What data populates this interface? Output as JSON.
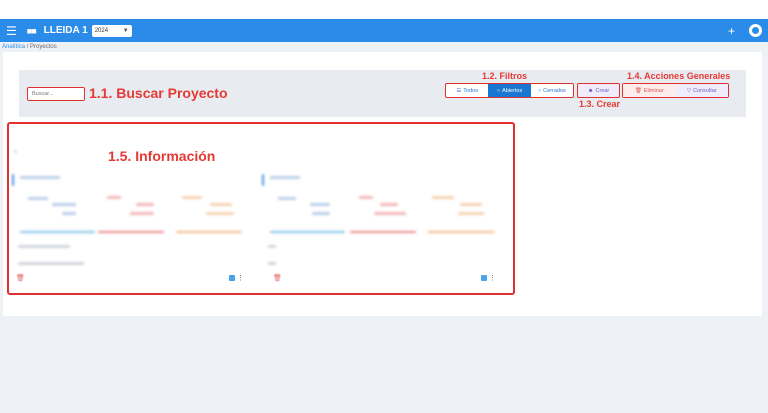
{
  "appbar": {
    "title": "LLEIDA 1",
    "year": "2024",
    "menu_icon": "hamburger-icon",
    "apps_icon": "apps-grid-icon",
    "add_icon": "plus-icon",
    "avatar_icon": "user-avatar-icon"
  },
  "breadcrumb": {
    "root": "Analítica",
    "separator": "/",
    "current": "Proyectos"
  },
  "search": {
    "placeholder": "Buscar..."
  },
  "filters": {
    "todos": "Todos",
    "abiertos": "Abiertos",
    "cerrados": "Cerrados"
  },
  "actions": {
    "crear": "Crear",
    "eliminar": "Eliminar",
    "consultar": "Consultar"
  },
  "annotations": {
    "a11": "1.1. Buscar Proyecto",
    "a12": "1.2. Filtros",
    "a13": "1.3. Crear",
    "a14": "1.4. Acciones Generales",
    "a15": "1.5. Información"
  },
  "colors": {
    "appbar": "#2b8be8",
    "annotation": "#e53935",
    "filter_active": "#1976d2",
    "delete": "#e25757",
    "consult": "#6b5fc7"
  }
}
